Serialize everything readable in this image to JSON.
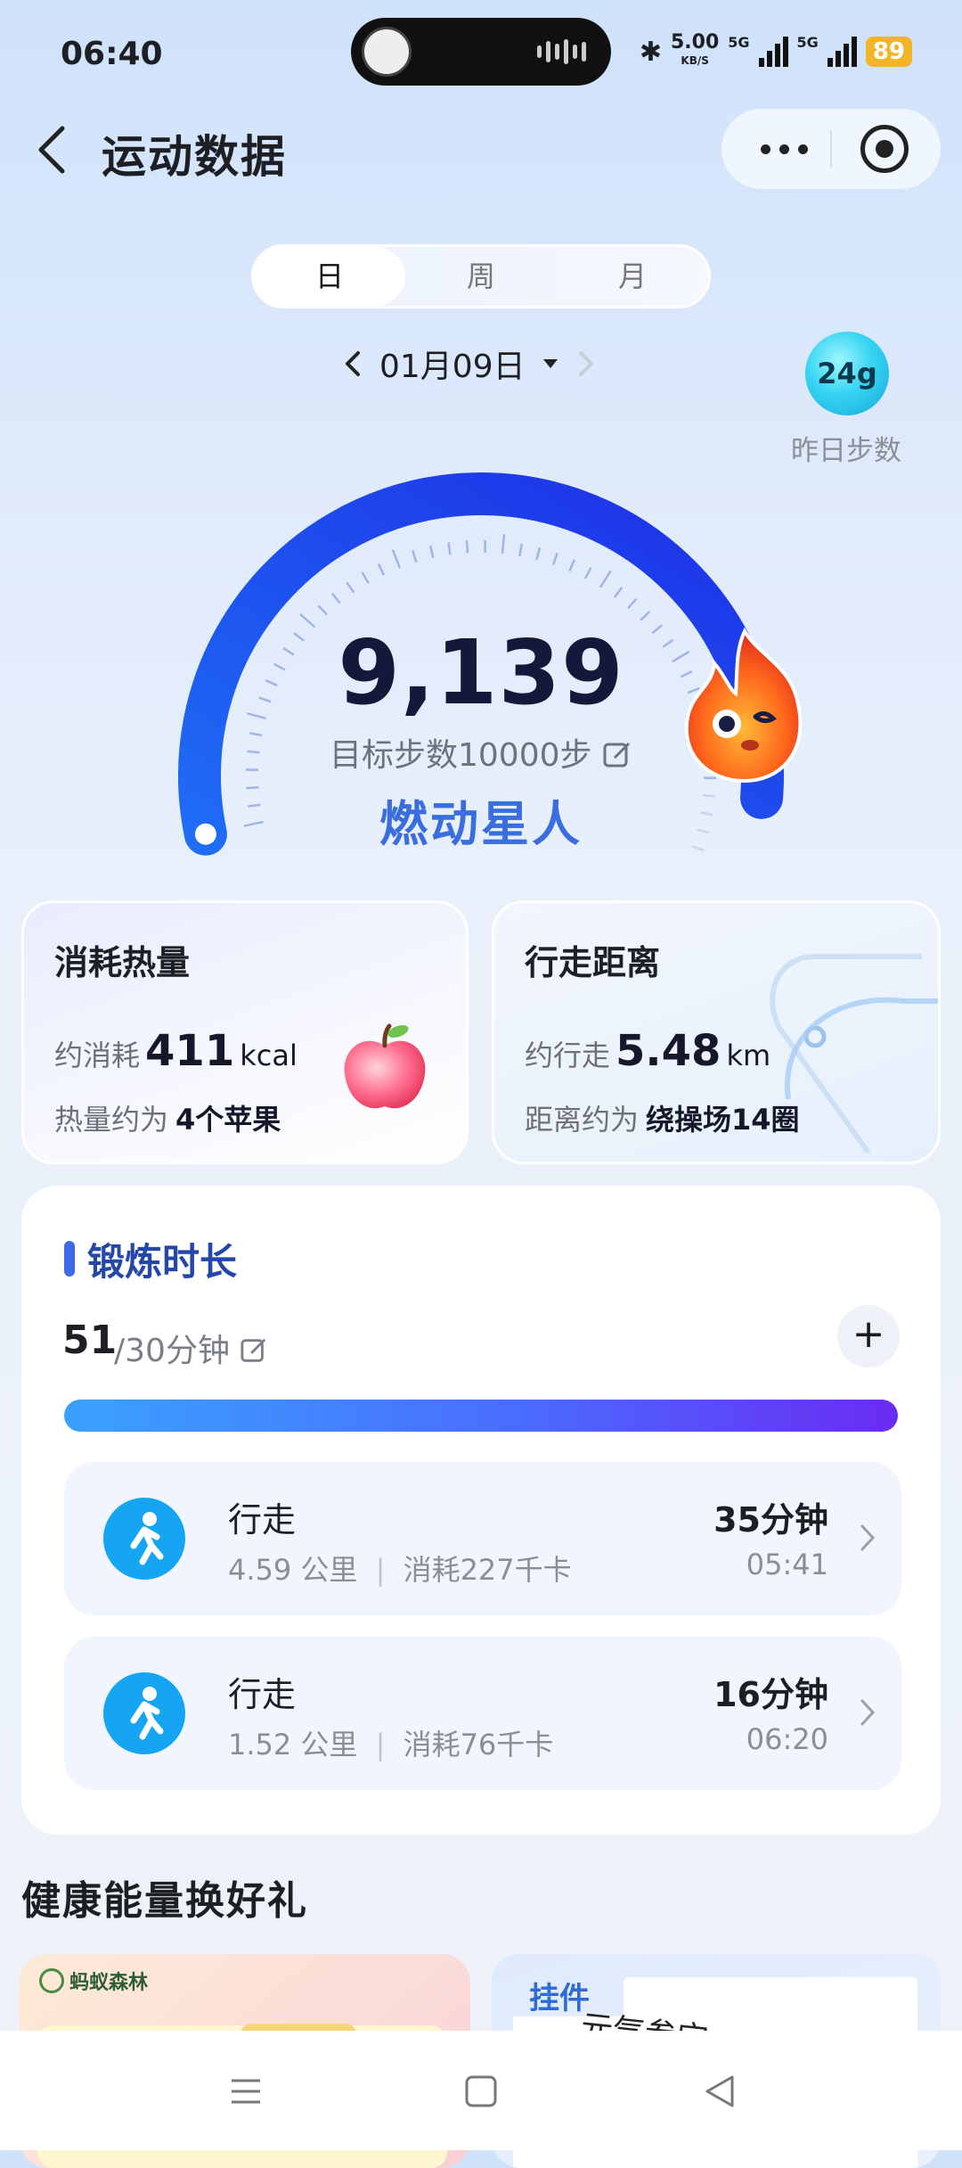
{
  "status_bar": {
    "time": "06:40",
    "net_speed_top": "5.00",
    "net_speed_unit": "KB/S",
    "sim1": "5G",
    "sim2": "5G",
    "battery": "89"
  },
  "header": {
    "title": "运动数据"
  },
  "tabs": [
    {
      "label": "日",
      "active": true
    },
    {
      "label": "周",
      "active": false
    },
    {
      "label": "月",
      "active": false
    }
  ],
  "date": {
    "label": "01月09日"
  },
  "yesterday": {
    "badge": "24g",
    "label": "昨日步数"
  },
  "steps": {
    "value": "9,139",
    "goal_text": "目标步数10000步",
    "progress_fraction": 0.9139,
    "title_badge": "燃动星人"
  },
  "calories": {
    "title": "消耗热量",
    "prefix": "约消耗",
    "value": "411",
    "unit": "kcal",
    "compare_prefix": "热量约为",
    "compare_value": "4个苹果"
  },
  "distance": {
    "title": "行走距离",
    "prefix": "约行走",
    "value": "5.48",
    "unit": "km",
    "compare_prefix": "距离约为",
    "compare_value": "绕操场14圈"
  },
  "exercise": {
    "title": "锻炼时长",
    "value": "51",
    "goal": "/30分钟",
    "add_label": "+",
    "progress_fraction": 1.0,
    "activities": [
      {
        "name": "行走",
        "distance": "4.59 公里",
        "sep": "|",
        "calories": "消耗227千卡",
        "duration": "35分钟",
        "time": "05:41"
      },
      {
        "name": "行走",
        "distance": "1.52 公里",
        "sep": "|",
        "calories": "消耗76千卡",
        "duration": "16分钟",
        "time": "06:20"
      }
    ]
  },
  "rewards": {
    "title": "健康能量换好礼",
    "promo1_tag": "蚂蚁森林",
    "promo2_label": "挂件",
    "promo2_text": "元气叁宝"
  },
  "colors": {
    "accent": "#3d69e6",
    "gauge": "#1a3cf0",
    "activity_icon": "#16a5f2",
    "battery": "#f2b526"
  }
}
